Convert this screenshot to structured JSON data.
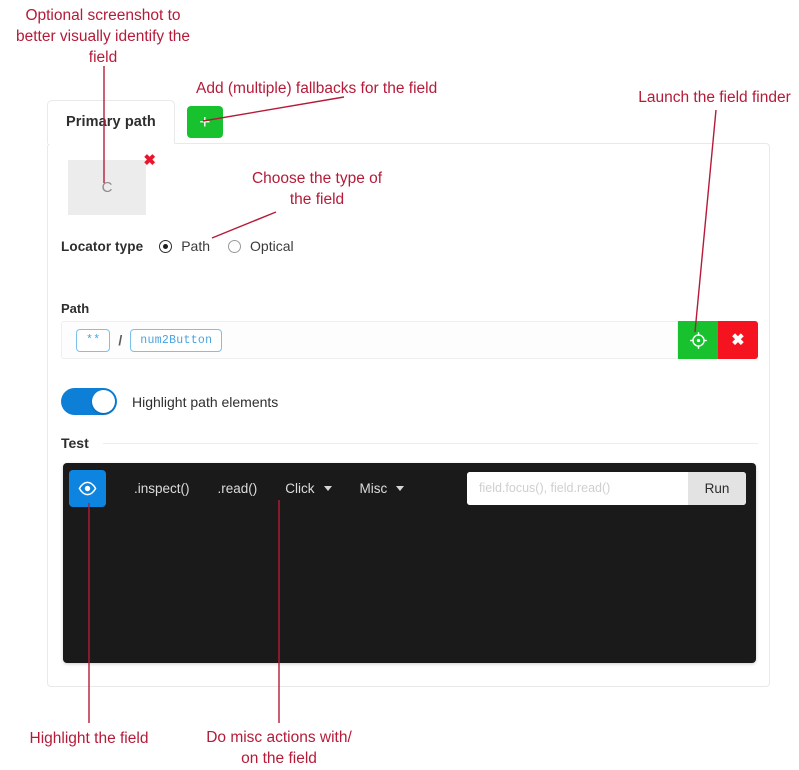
{
  "annotations": [
    {
      "id": "screenshot-note",
      "text": "Optional screenshot to\nbetter visually identify the\nfield"
    },
    {
      "id": "fallbacks-note",
      "text": "Add (multiple) fallbacks for the field"
    },
    {
      "id": "field-finder-note",
      "text": "Launch the field finder"
    },
    {
      "id": "locator-type-note",
      "text": "Choose the type of\nthe field"
    },
    {
      "id": "highlight-note",
      "text": "Highlight the field"
    },
    {
      "id": "misc-note",
      "text": "Do misc actions with/\non the field"
    }
  ],
  "card": {
    "tab": {
      "label": "Primary path",
      "add_fallback_label": "+"
    },
    "screenshot": {
      "placeholder_glyph": "C",
      "remove_label": "✖"
    },
    "locator_type": {
      "label": "Locator type",
      "options": [
        {
          "label": "Path",
          "selected": true
        },
        {
          "label": "Optical",
          "selected": false
        }
      ]
    },
    "path": {
      "label": "Path",
      "chips": [
        "**",
        "num2Button"
      ],
      "separator": "/",
      "finder_icon": "crosshair-icon",
      "clear_label": "✖"
    },
    "highlight_toggle": {
      "label": "Highlight path elements",
      "on": true
    },
    "test": {
      "title": "Test",
      "highlight_icon": "eye-icon",
      "actions": [
        {
          "label": ".inspect()",
          "has_caret": false
        },
        {
          "label": ".read()",
          "has_caret": false
        },
        {
          "label": "Click",
          "has_caret": true
        },
        {
          "label": "Misc",
          "has_caret": true
        }
      ],
      "expression_placeholder": "field.focus(), field.read()",
      "expression_value": "",
      "run_label": "Run"
    }
  },
  "colors": {
    "annotation": "#b51b38",
    "green": "#18c22f",
    "red": "#f4131f",
    "blue": "#0d85e0",
    "toggle_blue": "#0d7fd6",
    "console_bg": "#1a1a1a",
    "chip_blue": "#4aa3e0"
  }
}
